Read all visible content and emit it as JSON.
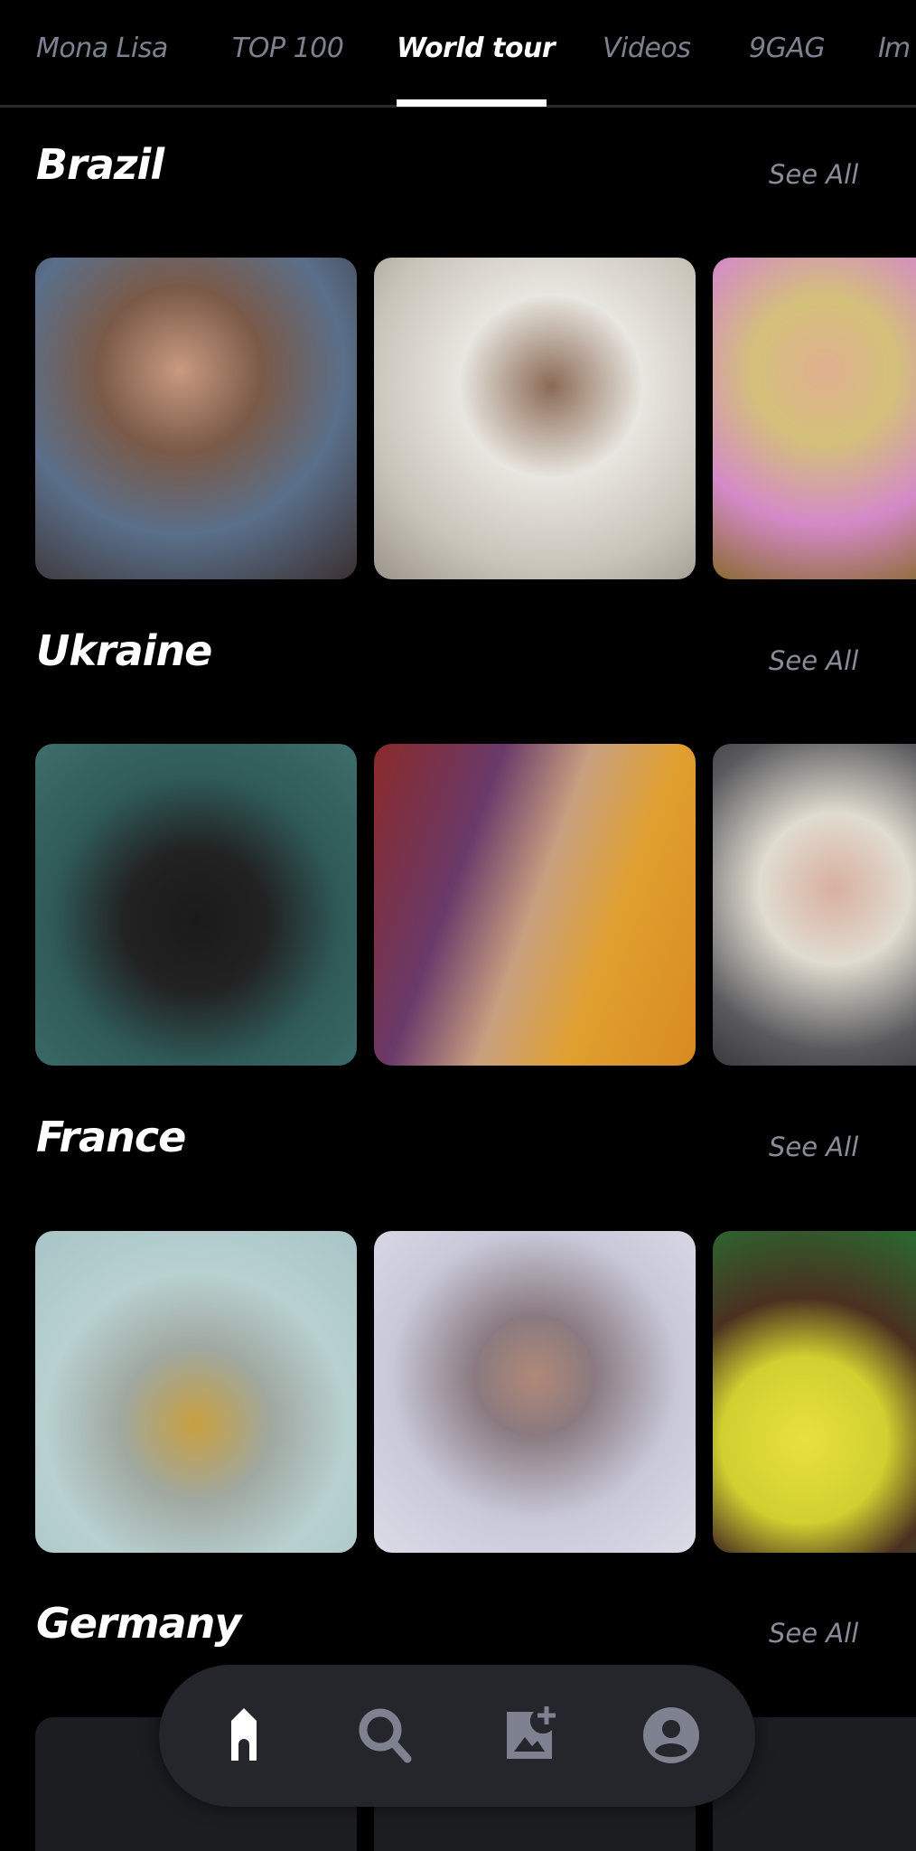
{
  "tabs": [
    {
      "label": "Mona Lisa"
    },
    {
      "label": "TOP 100"
    },
    {
      "label": "World tour",
      "active": true
    },
    {
      "label": "Videos"
    },
    {
      "label": "9GAG"
    },
    {
      "label": "Im"
    }
  ],
  "sections": [
    {
      "title": "Brazil",
      "see_all": "See All"
    },
    {
      "title": "Ukraine",
      "see_all": "See All"
    },
    {
      "title": "France",
      "see_all": "See All"
    },
    {
      "title": "Germany",
      "see_all": "See All"
    }
  ],
  "bottom_nav": {
    "items": [
      {
        "icon": "home-icon",
        "active": true
      },
      {
        "icon": "search-icon"
      },
      {
        "icon": "add-image-icon"
      },
      {
        "icon": "profile-icon"
      }
    ]
  },
  "colors": {
    "background": "#000000",
    "tab_inactive": "#7d8190",
    "nav_bg": "#25262b",
    "icon_inactive": "#7d8190"
  }
}
